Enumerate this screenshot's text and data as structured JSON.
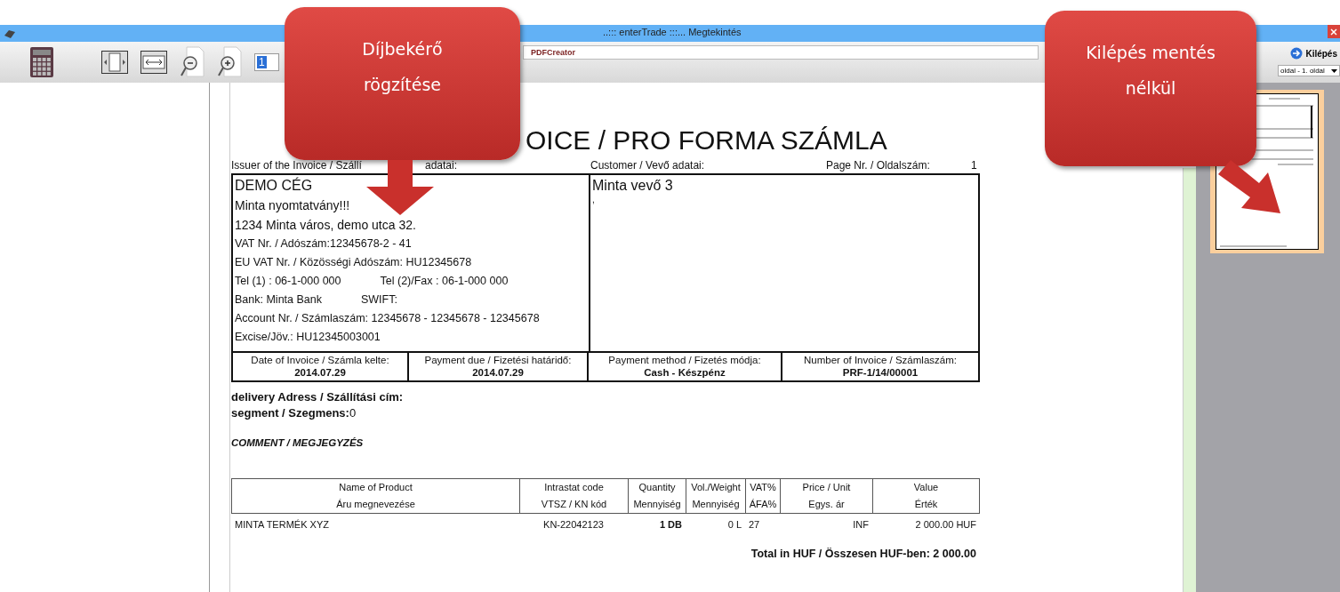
{
  "window": {
    "title": "..::: enterTrade :::... Megtekintés"
  },
  "toolbar": {
    "page_number": "1",
    "printer": "PDFCreator",
    "exit_button": "Kilépés",
    "page_select": "oldal - 1. oldal"
  },
  "document": {
    "title": "OICE / PRO FORMA SZÁMLA",
    "issuer_label": [
      "Issuer of the Invoice / Szállí",
      "adatai:"
    ],
    "customer_label": "Customer / Vevő adatai:",
    "page_label": "Page Nr. / Oldalszám:",
    "page_number": "1",
    "issuer_lines": [
      {
        "kind": "large",
        "parts": [
          "DEMO CÉG"
        ]
      },
      {
        "kind": "medium",
        "parts": [
          "Minta nyomtatvány!!!"
        ]
      },
      {
        "kind": "medium",
        "parts": [
          "1234   Minta város, demo utca 32."
        ]
      },
      {
        "kind": "small",
        "parts": [
          "VAT Nr. / Adószám:12345678-2 - 41"
        ]
      },
      {
        "kind": "small",
        "parts": [
          "EU VAT Nr. / Közösségi Adószám: HU12345678"
        ]
      },
      {
        "kind": "small",
        "parts": [
          "Tel (1) : 06-1-000 000",
          "Tel (2)/Fax : 06-1-000 000"
        ]
      },
      {
        "kind": "small",
        "parts": [
          "Bank: Minta Bank",
          "SWIFT:"
        ]
      },
      {
        "kind": "small",
        "parts": [
          "Account Nr. / Számlaszám:  12345678 - 12345678 - 12345678"
        ]
      },
      {
        "kind": "small",
        "parts": [
          "Excise/Jöv.: HU12345003001"
        ]
      }
    ],
    "customer_name": "Minta vevő 3",
    "customer_line": ",",
    "info_cells": [
      {
        "label": "Date of Invoice / Számla kelte:",
        "value": "2014.07.29"
      },
      {
        "label": "Payment due / Fizetési határidő:",
        "value": "2014.07.29"
      },
      {
        "label": "Payment method / Fizetés módja:",
        "value": "Cash - Készpénz"
      },
      {
        "label": "Number of Invoice / Számlaszám:",
        "value": "PRF-1/14/00001"
      }
    ],
    "delivery": "delivery Adress / Szállítási cím:",
    "segment_label": "segment / Szegmens:",
    "segment_value": "0",
    "comment": "COMMENT / MEGJEGYZÉS",
    "table": {
      "header_rows": [
        [
          "Name of Product",
          "Intrastat code",
          "Quantity",
          "Vol./Weight",
          "VAT%",
          "Price / Unit",
          "Value"
        ],
        [
          "Áru megnevezése",
          "VTSZ / KN kód",
          "Mennyiség",
          "Mennyiség",
          "ÁFA%",
          "Egys. ár",
          "Érték"
        ]
      ],
      "rows": [
        [
          "MINTA TERMÉK XYZ",
          "KN-22042123",
          "1 DB",
          "0 L",
          "27",
          "INF",
          "2 000.00 HUF"
        ]
      ]
    },
    "total": "Total in HUF / Összesen HUF-ben:  2 000.00"
  },
  "callouts": [
    {
      "lines": [
        "Díjbekérő",
        "rögzítése"
      ],
      "kind": "down"
    },
    {
      "lines": [
        "Kilépés mentés",
        "nélkül"
      ],
      "kind": "diagonal"
    }
  ]
}
